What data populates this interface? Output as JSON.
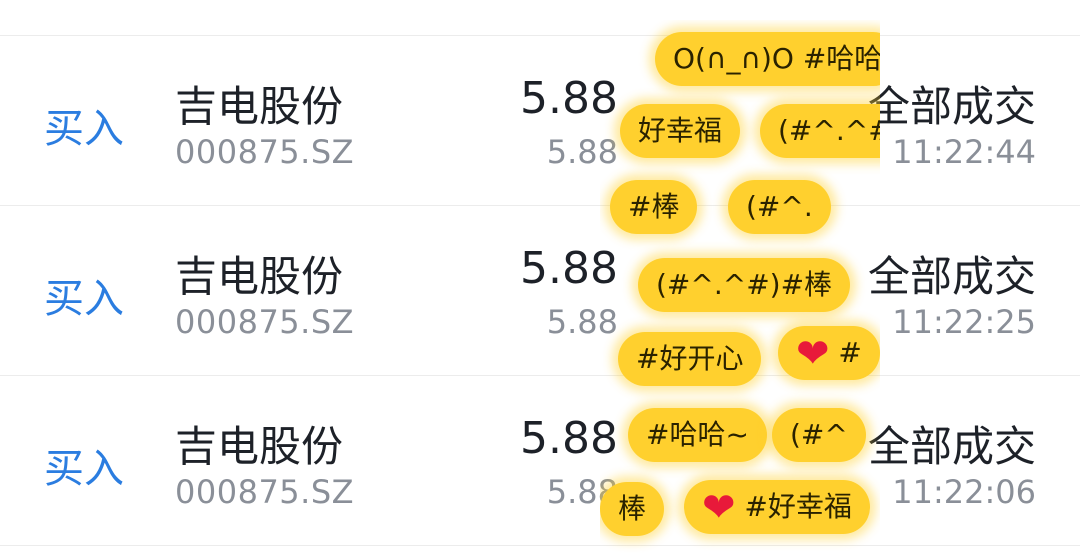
{
  "trades": [
    {
      "side": "买入",
      "name": "吉电股份",
      "code": "000875.SZ",
      "price": "5.88",
      "price_sub": "5.88",
      "status": "全部成交",
      "time": "11:22:44"
    },
    {
      "side": "买入",
      "name": "吉电股份",
      "code": "000875.SZ",
      "price": "5.88",
      "price_sub": "5.88",
      "status": "全部成交",
      "time": "11:22:25"
    },
    {
      "side": "买入",
      "name": "吉电股份",
      "code": "000875.SZ",
      "price": "5.88",
      "price_sub": "5.88",
      "status": "全部成交",
      "time": "11:22:06"
    }
  ],
  "danmaku": [
    {
      "text": "O(∩_∩)O #哈哈"
    },
    {
      "text": "好幸福"
    },
    {
      "text": "(#^.^#)#棒"
    },
    {
      "text": "#棒"
    },
    {
      "text": "(#^."
    },
    {
      "text": "(#^.^#)#棒"
    },
    {
      "text": "#好开心"
    },
    {
      "text": "#"
    },
    {
      "text": "#哈哈~"
    },
    {
      "text": "(#^"
    },
    {
      "text": "棒"
    },
    {
      "text": "#好幸福"
    }
  ],
  "colors": {
    "side_buy": "#2b7de0",
    "bubble": "#ffd02e",
    "heart": "#e8193a"
  }
}
